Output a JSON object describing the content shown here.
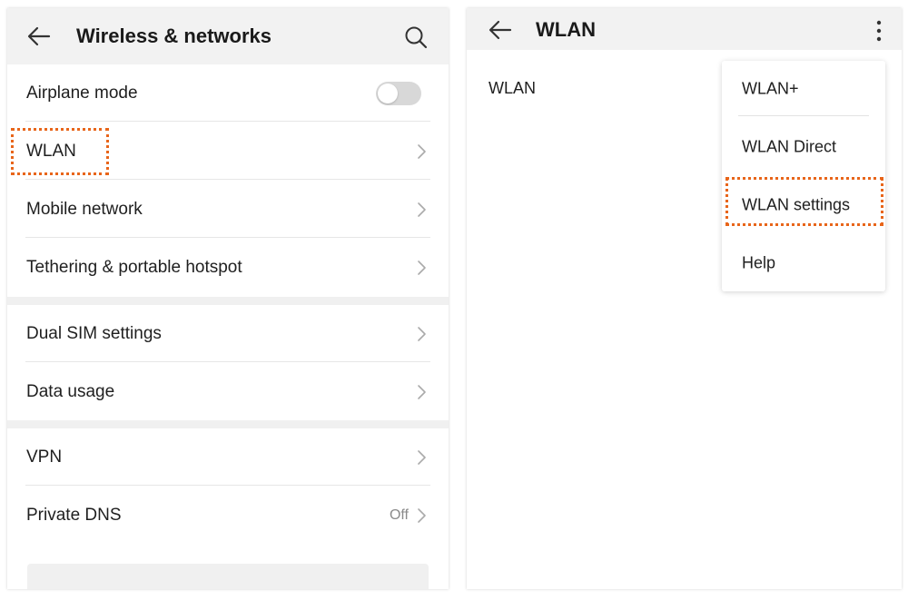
{
  "left_screen": {
    "header": {
      "title": "Wireless & networks",
      "back_icon": "arrow-left-icon",
      "search_icon": "search-icon"
    },
    "rows": [
      {
        "label": "Airplane mode",
        "control": "toggle",
        "toggle_on": false
      },
      {
        "label": "WLAN"
      },
      {
        "label": "Mobile network"
      },
      {
        "label": "Tethering & portable hotspot"
      },
      {
        "label": "Dual SIM settings"
      },
      {
        "label": "Data usage"
      },
      {
        "label": "VPN"
      },
      {
        "label": "Private DNS",
        "value": "Off"
      }
    ]
  },
  "right_screen": {
    "header": {
      "title": "WLAN",
      "back_icon": "arrow-left-icon",
      "more_icon": "more-vertical-icon"
    },
    "content_label": "WLAN",
    "menu": {
      "items": [
        "WLAN+",
        "WLAN Direct",
        "WLAN settings",
        "Help"
      ]
    }
  },
  "colors": {
    "highlight": "#e8651a",
    "header_bg": "#f2f2f2",
    "divider": "#e6e6e6",
    "toggle_off": "#d8d8d8"
  }
}
